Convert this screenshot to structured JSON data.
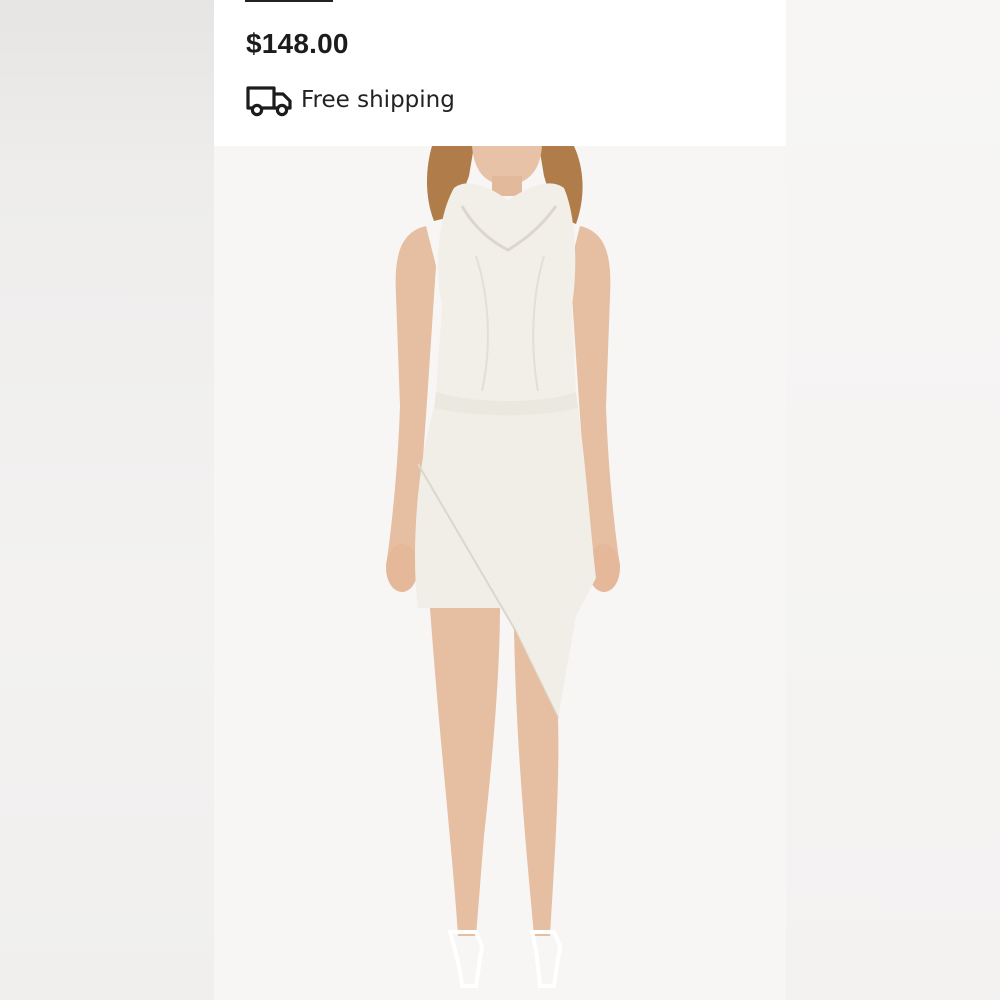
{
  "listing": {
    "price": "$148.00",
    "shipping_label": "Free shipping",
    "shipping_icon": "truck-icon",
    "product_image_alt": "White halter cowl-neck dress with asymmetric wrap skirt"
  },
  "colors": {
    "background": "#f1f0ef",
    "panel": "#ffffff",
    "text": "#1c1c1c",
    "dress": "#f4f2ec"
  }
}
